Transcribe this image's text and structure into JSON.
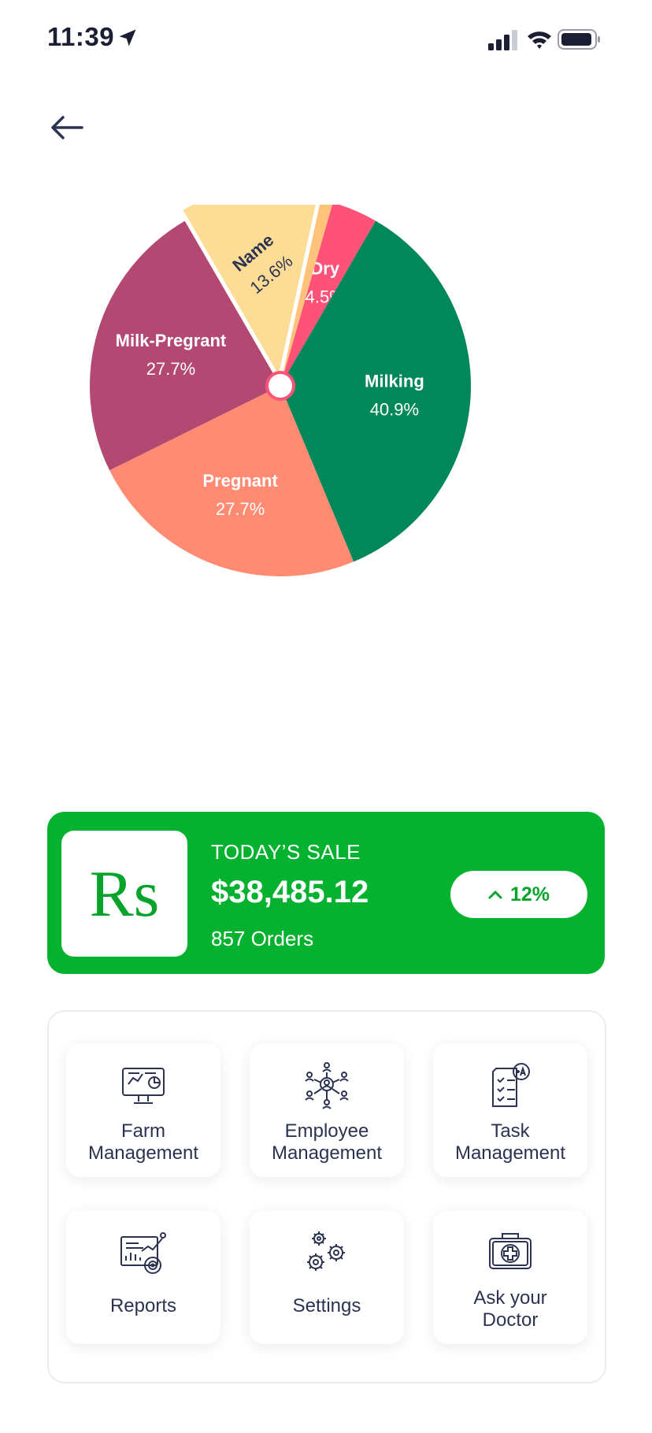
{
  "status_bar": {
    "time": "11:39"
  },
  "back": {
    "icon": "arrow-left-icon"
  },
  "chart_data": {
    "type": "pie",
    "slices": [
      {
        "label": "Dry",
        "value": 4.5,
        "display": "4.5%",
        "color": "#fe5279"
      },
      {
        "label": "Milking",
        "value": 40.9,
        "display": "40.9%",
        "color": "#00875a"
      },
      {
        "label": "Pregnant",
        "value": 27.7,
        "display": "27.7%",
        "color": "#ff8b73"
      },
      {
        "label": "Milk-Pregrant",
        "value": 27.7,
        "display": "27.7%",
        "color": "#b34873"
      },
      {
        "label": "Name",
        "value": 13.6,
        "display": "13.6%",
        "color": "#fddd96"
      },
      {
        "label": "",
        "value": 1.2,
        "display": "",
        "color": "#ffc27a"
      }
    ],
    "highlighted_slice": "Name"
  },
  "sale": {
    "logo": "Rs",
    "label": "TODAY’S SALE",
    "amount": "$38,485.12",
    "orders": "857 Orders",
    "change": "12%",
    "change_icon": "chevron-up-icon"
  },
  "menu": {
    "items": [
      {
        "label": "Farm\nManagement",
        "icon": "farm-monitor-icon"
      },
      {
        "label": "Employee\nManagement",
        "icon": "employee-network-icon"
      },
      {
        "label": "Task\nManagement",
        "icon": "task-checklist-icon"
      },
      {
        "label": "Reports",
        "icon": "reports-chart-icon"
      },
      {
        "label": "Settings",
        "icon": "gears-icon"
      },
      {
        "label": "Ask your\nDoctor",
        "icon": "first-aid-kit-icon"
      }
    ]
  },
  "colors": {
    "accent": "#04b22f",
    "text": "#2b3350"
  }
}
